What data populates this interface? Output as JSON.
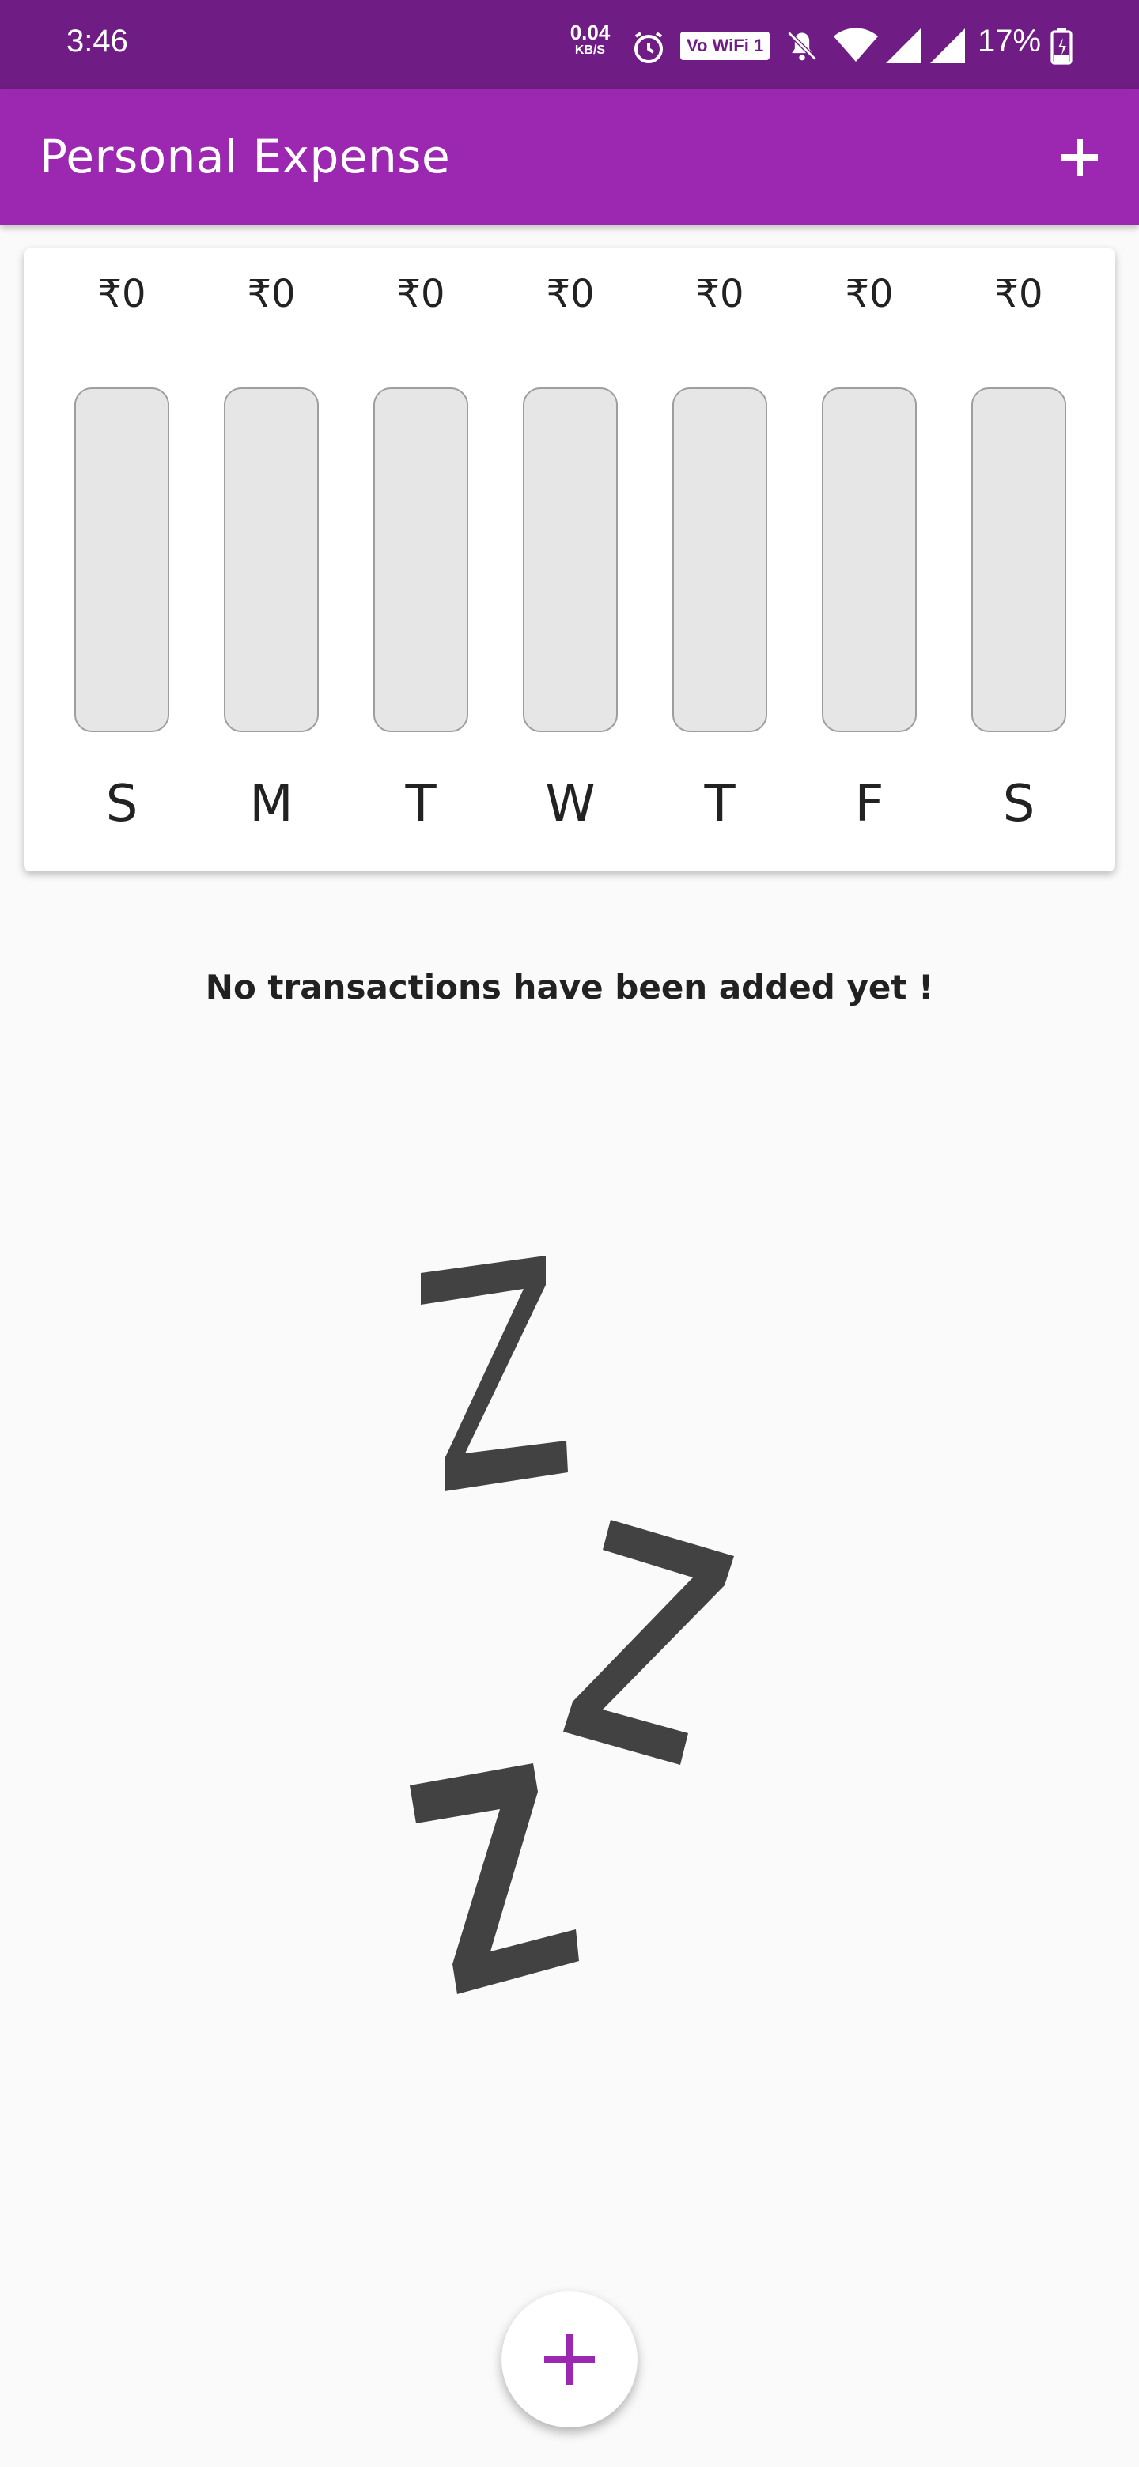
{
  "status_bar": {
    "time": "3:46",
    "net_speed_value": "0.04",
    "net_speed_unit": "KB/S",
    "wifi_label": "Vo WiFi 1",
    "battery_percent": "17%",
    "icons": [
      "alarm-icon",
      "wifi-calling-icon",
      "mute-notifications-icon",
      "wifi-icon",
      "signal-icon",
      "signal-icon",
      "battery-charging-icon"
    ]
  },
  "app_bar": {
    "title": "Personal Expense",
    "add_icon": "plus-icon"
  },
  "chart_data": {
    "type": "bar",
    "categories": [
      "S",
      "M",
      "T",
      "W",
      "T",
      "F",
      "S"
    ],
    "values": [
      0,
      0,
      0,
      0,
      0,
      0,
      0
    ],
    "labels": [
      "₹0",
      "₹0",
      "₹0",
      "₹0",
      "₹0",
      "₹0",
      "₹0"
    ],
    "fill_fractions": [
      0,
      0,
      0,
      0,
      0,
      0,
      0
    ]
  },
  "empty_state": {
    "message": "No transactions have been added yet !",
    "image": "sleeping-zzz-icon"
  },
  "fab": {
    "icon": "plus-icon"
  },
  "colors": {
    "status_bar": "#6f1d84",
    "primary": "#9c27b0",
    "background": "#fafafa",
    "bar_track": "#e6e6e6",
    "zzz": "#424242"
  }
}
